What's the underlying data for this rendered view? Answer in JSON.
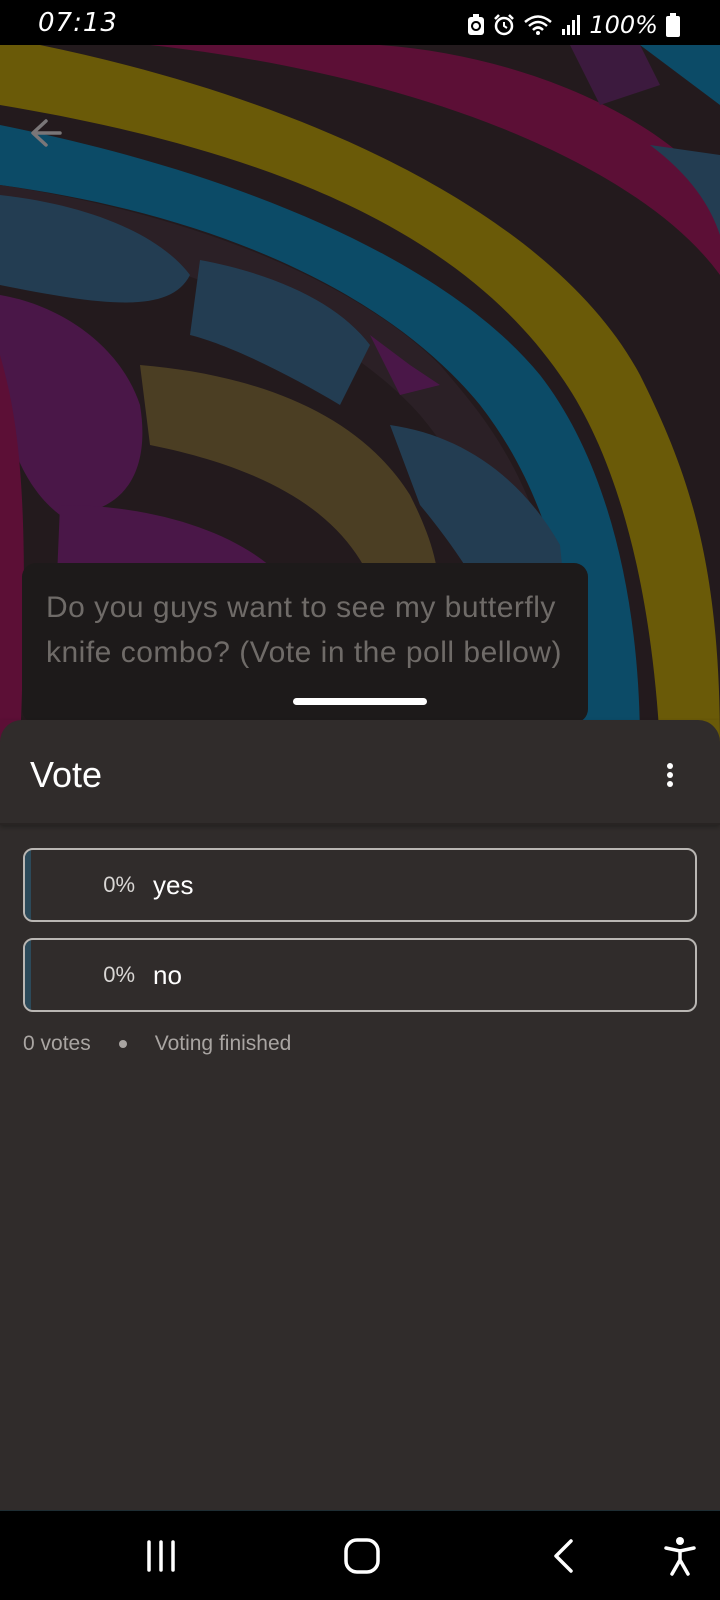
{
  "status_bar": {
    "time": "07:13",
    "battery_text": "100%",
    "icons": [
      "battery-saver-icon",
      "alarm-icon",
      "wifi-icon",
      "signal-icon",
      "battery-icon"
    ]
  },
  "header": {
    "back_icon": "arrow-left-icon"
  },
  "post": {
    "caption": "Do you guys want to see my butterfly knife combo? (Vote in the poll bellow)"
  },
  "sheet": {
    "title": "Vote",
    "menu_icon": "more-vertical-icon",
    "options": [
      {
        "percent": "0%",
        "label": "yes",
        "share": 0
      },
      {
        "percent": "0%",
        "label": "no",
        "share": 0
      }
    ],
    "votes": "0 votes",
    "status": "Voting finished"
  },
  "nav_bar": {
    "icons": [
      "recent-apps-icon",
      "home-icon",
      "back-icon",
      "accessibility-icon"
    ]
  },
  "colors": {
    "sheet_bg": "#302c2b",
    "option_border": "#b9b6b3",
    "fill_accent": "#2c4a5a"
  }
}
